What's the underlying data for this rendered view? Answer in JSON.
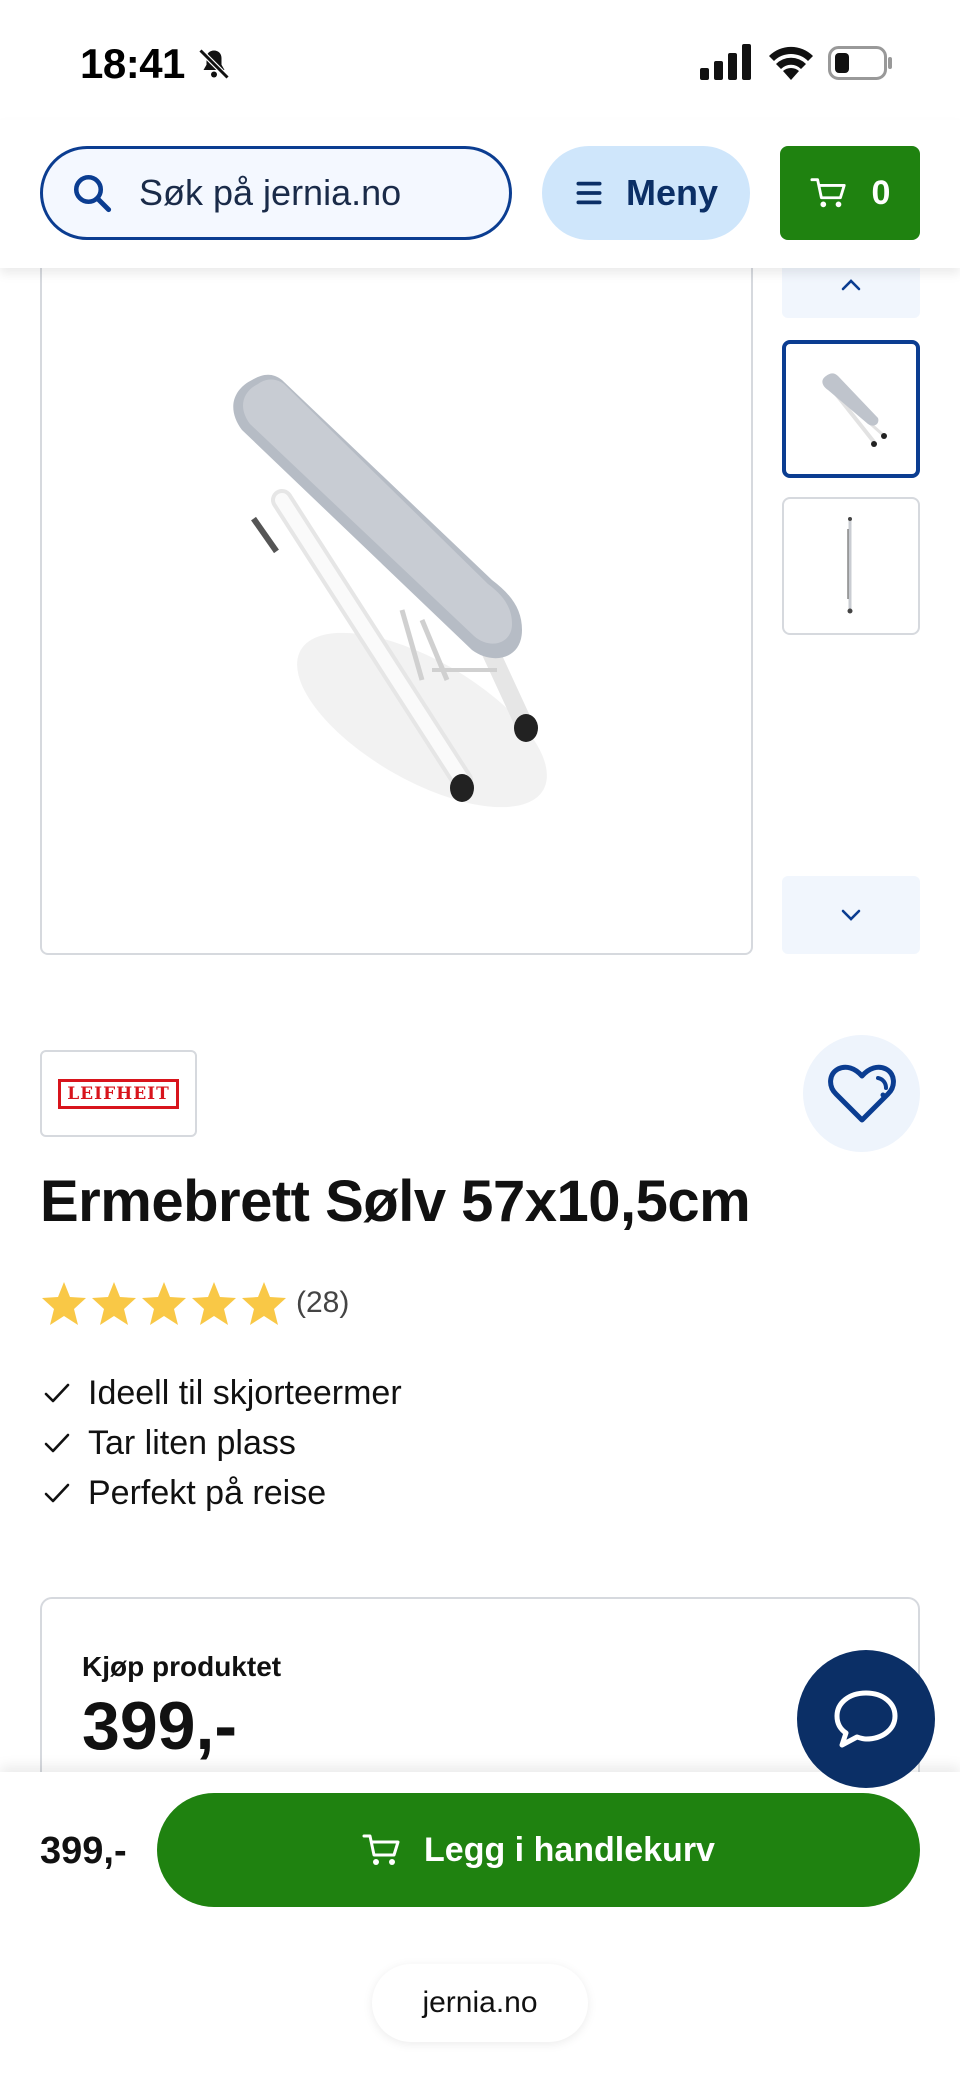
{
  "status_bar": {
    "time": "18:41"
  },
  "header": {
    "search_placeholder": "Søk på jernia.no",
    "menu_label": "Meny",
    "cart_count": "0"
  },
  "product": {
    "brand": "LEIFHEIT",
    "title": "Ermebrett Sølv 57x10,5cm",
    "rating": {
      "stars": 5,
      "max_stars": 5,
      "count_text": "(28)"
    },
    "features": [
      "Ideell til skjorteermer",
      "Tar liten plass",
      "Perfekt på reise"
    ]
  },
  "buy_box": {
    "label": "Kjøp produktet",
    "price": "399,-"
  },
  "sticky_bar": {
    "price": "399,-",
    "add_to_cart_label": "Legg i handlekurv"
  },
  "browser": {
    "url": "jernia.no"
  },
  "colors": {
    "primary_blue": "#0b3d91",
    "dark_blue": "#0b2f66",
    "green": "#1f8210",
    "star": "#f9c846",
    "light_blue": "#cfe6fb"
  },
  "icons": [
    "bell-muted-icon",
    "signal-icon",
    "wifi-icon",
    "battery-icon",
    "search-icon",
    "menu-icon",
    "cart-icon",
    "chevron-up-icon",
    "chevron-down-icon",
    "heart-icon",
    "star-icon",
    "check-icon",
    "chat-icon"
  ]
}
